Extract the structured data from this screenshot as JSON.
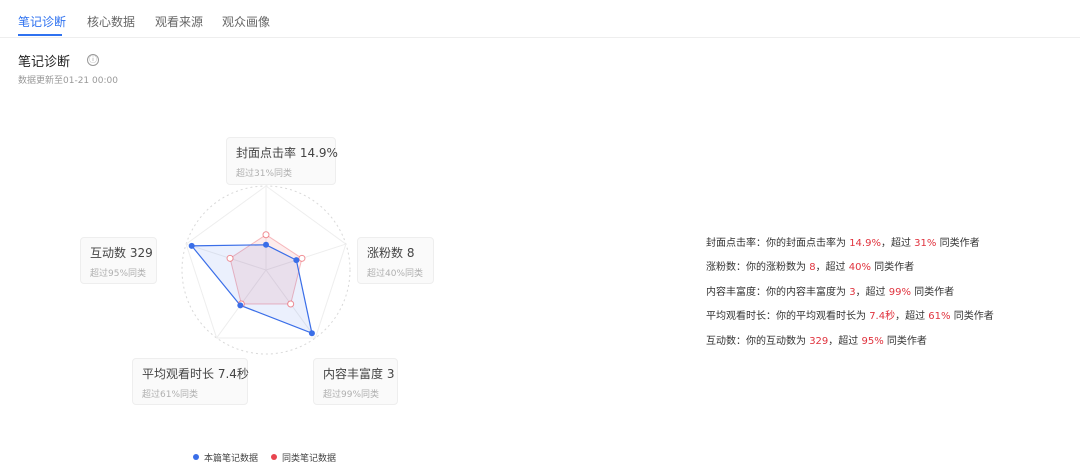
{
  "tabs": [
    "笔记诊断",
    "核心数据",
    "观看来源",
    "观众画像"
  ],
  "section": {
    "title": "笔记诊断",
    "info_icon": "ⓘ",
    "update_text": "数据更新至01-21 00:00"
  },
  "colors": {
    "accent": "#2f72f0",
    "highlight": "#e0333e",
    "series_this": "#3a6ee8",
    "series_peer": "#e8454f"
  },
  "cards": {
    "cover_ctr": {
      "label": "封面点击率 14.9%",
      "sub": "超过31%同类"
    },
    "followers": {
      "label": "涨粉数 8",
      "sub": "超过40%同类"
    },
    "richness": {
      "label": "内容丰富度 3",
      "sub": "超过99%同类"
    },
    "watch_time": {
      "label": "平均观看时长 7.4秒",
      "sub": "超过61%同类"
    },
    "interactions": {
      "label": "互动数 329",
      "sub": "超过95%同类"
    }
  },
  "chart_data": {
    "type": "radar",
    "axes": [
      "封面点击率",
      "涨粉数",
      "内容丰富度",
      "平均观看时长",
      "互动数"
    ],
    "range": [
      0,
      1
    ],
    "series": [
      {
        "name": "本篇笔记数据",
        "values": [
          0.3,
          0.38,
          0.93,
          0.52,
          0.93
        ]
      },
      {
        "name": "同类笔记数据",
        "values": [
          0.42,
          0.45,
          0.5,
          0.5,
          0.45
        ]
      }
    ]
  },
  "descriptions": [
    {
      "label": "封面点击率：",
      "text": "你的封面点击率为 ",
      "value": "14.9%",
      "mid": "，超过 ",
      "pct": "31%",
      "tail": " 同类作者"
    },
    {
      "label": "涨粉数：",
      "text": "你的涨粉数为 ",
      "value": "8",
      "mid": "，超过 ",
      "pct": "40%",
      "tail": " 同类作者"
    },
    {
      "label": "内容丰富度：",
      "text": "你的内容丰富度为 ",
      "value": "3",
      "mid": "，超过 ",
      "pct": "99%",
      "tail": " 同类作者"
    },
    {
      "label": "平均观看时长：",
      "text": "你的平均观看时长为 ",
      "value": "7.4秒",
      "mid": "，超过 ",
      "pct": "61%",
      "tail": " 同类作者"
    },
    {
      "label": "互动数：",
      "text": "你的互动数为 ",
      "value": "329",
      "mid": "，超过 ",
      "pct": "95%",
      "tail": " 同类作者"
    }
  ],
  "legend": [
    "本篇笔记数据",
    "同类笔记数据"
  ]
}
